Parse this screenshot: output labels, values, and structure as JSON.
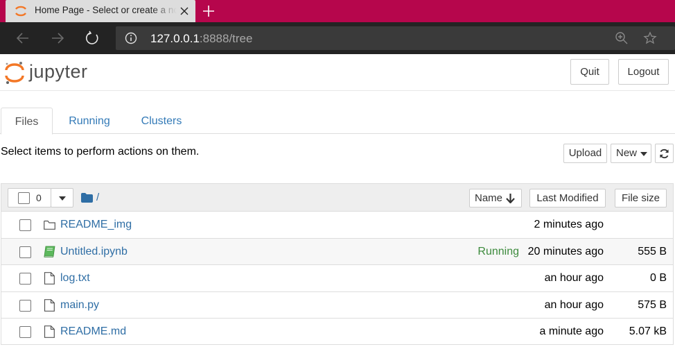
{
  "browser": {
    "tab_title": "Home Page - Select or create a notebook",
    "url_host": "127.0.0.1",
    "url_rest": ":8888/tree"
  },
  "header": {
    "logo_text": "jupyter",
    "quit_label": "Quit",
    "logout_label": "Logout"
  },
  "tabs": [
    {
      "label": "Files",
      "active": true
    },
    {
      "label": "Running",
      "active": false
    },
    {
      "label": "Clusters",
      "active": false
    }
  ],
  "toolbar": {
    "hint": "Select items to perform actions on them.",
    "upload_label": "Upload",
    "new_label": "New"
  },
  "list_header": {
    "selected_count": "0",
    "path": "/",
    "sort_name": "Name",
    "sort_modified": "Last Modified",
    "sort_size": "File size"
  },
  "files": [
    {
      "name": "README_img",
      "type": "folder",
      "running": "",
      "modified": "2 minutes ago",
      "size": ""
    },
    {
      "name": "Untitled.ipynb",
      "type": "notebook",
      "running": "Running",
      "modified": "20 minutes ago",
      "size": "555 B"
    },
    {
      "name": "log.txt",
      "type": "file",
      "running": "",
      "modified": "an hour ago",
      "size": "0 B"
    },
    {
      "name": "main.py",
      "type": "file",
      "running": "",
      "modified": "an hour ago",
      "size": "575 B"
    },
    {
      "name": "README.md",
      "type": "file",
      "running": "",
      "modified": "a minute ago",
      "size": "5.07 kB"
    }
  ],
  "colors": {
    "tabbar": "#b6064c",
    "link": "#2f6ea5",
    "running": "#3c8a3c",
    "jupyter_orange": "#f37726"
  }
}
